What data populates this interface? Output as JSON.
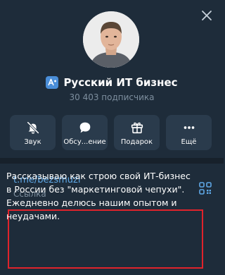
{
  "channel": {
    "title": "Русский ИТ бизнес",
    "subscribers": "30 403 подписчика"
  },
  "actions": [
    {
      "label": "Звук",
      "icon": "bell-off-icon"
    },
    {
      "label": "Обсу...ение",
      "icon": "chat-bubble-icon"
    },
    {
      "label": "Подарок",
      "icon": "gift-icon"
    },
    {
      "label": "Ещё",
      "icon": "more-dots-icon"
    }
  ],
  "info": {
    "link": "t.me/bezsmuzi",
    "link_caption": "Ссылка",
    "about": "Рассказываю как строю свой ИТ-бизнес в России без \"маркетинговой чепухи\". Ежедневно делюсь нашим опытом и неудачами."
  },
  "colors": {
    "background": "#1e2c3a",
    "button_bg": "#2a3b4c",
    "accent": "#5fa8e6",
    "muted": "#7d8e9e",
    "highlight_border": "#e0232b"
  }
}
